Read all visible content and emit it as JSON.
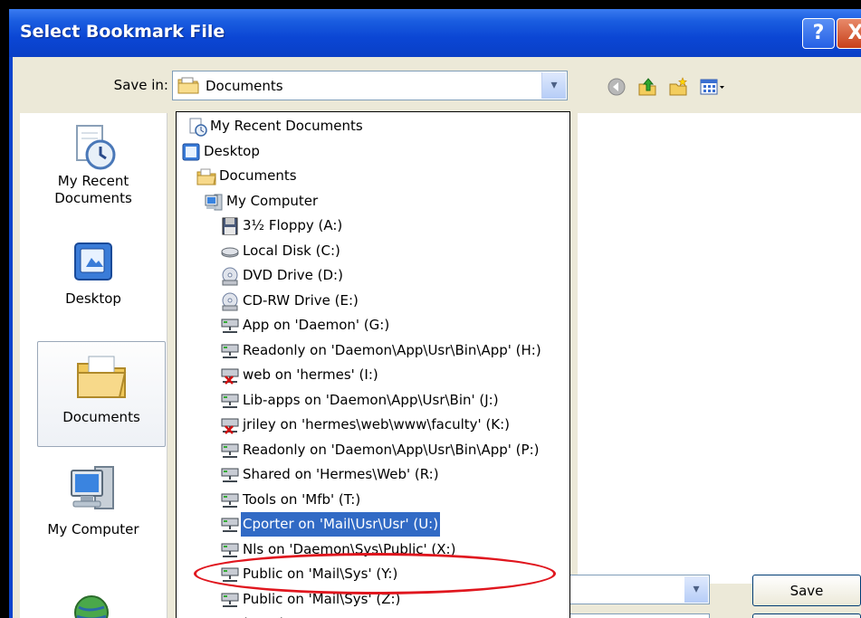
{
  "window": {
    "title": "Select Bookmark File",
    "help_label": "?",
    "close_label": "X"
  },
  "save_in": {
    "label": "Save in:",
    "value": "Documents",
    "arrow": "▾"
  },
  "toolbar": {
    "icons": [
      "back-icon",
      "up-folder-icon",
      "new-folder-icon",
      "view-menu-icon"
    ]
  },
  "places": [
    {
      "label_line1": "My Recent",
      "label_line2": "Documents",
      "icon": "recent-documents-icon"
    },
    {
      "label_line1": "Desktop",
      "label_line2": "",
      "icon": "desktop-icon"
    },
    {
      "label_line1": "Documents",
      "label_line2": "",
      "icon": "documents-folder-icon"
    },
    {
      "label_line1": "My Computer",
      "label_line2": "",
      "icon": "my-computer-icon"
    },
    {
      "label_line1": "",
      "label_line2": "",
      "icon": "network-icon"
    }
  ],
  "dropdown_items": [
    {
      "label": "My Recent Documents",
      "icon": "recent-documents-icon"
    },
    {
      "label": "Desktop",
      "icon": "desktop-icon"
    },
    {
      "label": "Documents",
      "icon": "documents-folder-icon"
    },
    {
      "label": "My Computer",
      "icon": "my-computer-icon"
    },
    {
      "label": "3½ Floppy (A:)",
      "icon": "floppy-drive-icon"
    },
    {
      "label": "Local Disk (C:)",
      "icon": "local-disk-icon"
    },
    {
      "label": "DVD Drive (D:)",
      "icon": "dvd-drive-icon"
    },
    {
      "label": "CD-RW Drive (E:)",
      "icon": "cd-drive-icon"
    },
    {
      "label": "App on 'Daemon' (G:)",
      "icon": "network-drive-icon"
    },
    {
      "label": "Readonly on 'Daemon\\App\\Usr\\Bin\\App' (H:)",
      "icon": "network-drive-icon"
    },
    {
      "label": "web on 'hermes' (I:)",
      "icon": "disconnected-network-drive-icon"
    },
    {
      "label": "Lib-apps on 'Daemon\\App\\Usr\\Bin' (J:)",
      "icon": "network-drive-icon"
    },
    {
      "label": "jriley on 'hermes\\web\\www\\faculty' (K:)",
      "icon": "disconnected-network-drive-icon"
    },
    {
      "label": "Readonly on 'Daemon\\App\\Usr\\Bin\\App' (P:)",
      "icon": "network-drive-icon"
    },
    {
      "label": "Shared on 'Hermes\\Web' (R:)",
      "icon": "network-drive-icon"
    },
    {
      "label": "Tools on 'Mfb' (T:)",
      "icon": "network-drive-icon"
    },
    {
      "label": "Cporter on 'Mail\\Usr\\Usr' (U:)",
      "icon": "network-drive-icon",
      "selected": true
    },
    {
      "label": "Nls on 'Daemon\\Sys\\Public' (X:)",
      "icon": "network-drive-icon"
    },
    {
      "label": "Public on 'Mail\\Sys' (Y:)",
      "icon": "network-drive-icon"
    },
    {
      "label": "Public on 'Mail\\Sys' (Z:)",
      "icon": "network-drive-icon"
    },
    {
      "label": "Shared Documents",
      "icon": "shared-folder-icon"
    }
  ],
  "buttons": {
    "save": "Save"
  },
  "colors": {
    "selection": "#316ac5",
    "annotation": "#e0161e",
    "title_bar": "#0b46d4"
  }
}
